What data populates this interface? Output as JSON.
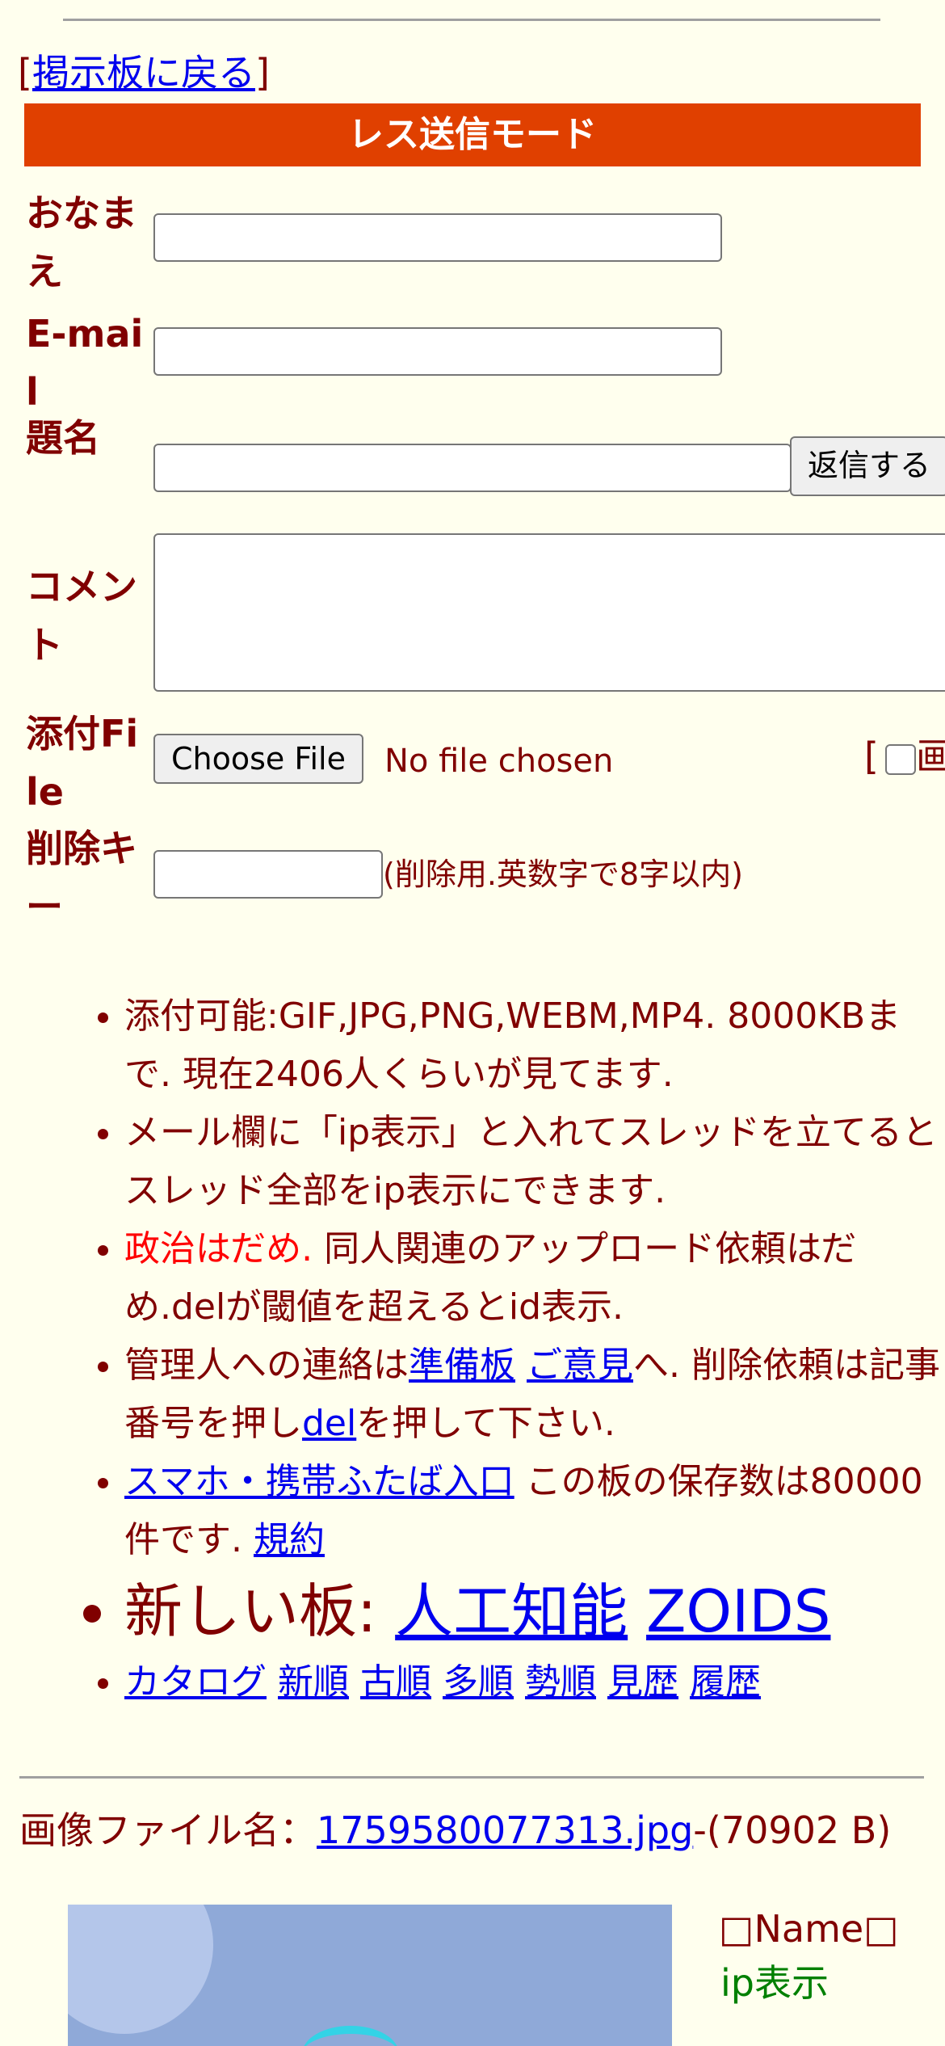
{
  "nav": {
    "back_left": "[",
    "back_link": "掲示板に戻る",
    "back_right": "]"
  },
  "mode_title": "レス送信モード",
  "form": {
    "name_label": "おなまえ",
    "email_label": "E-mail",
    "subject_label": "題名",
    "comment_label": "コメント",
    "attach_label": "添付File",
    "delkey_label": "削除キー",
    "submit_label": "返信する",
    "choose_file_label": "Choose File",
    "no_file_text": "No file chosen",
    "attach_extra_bracket": "[",
    "attach_extra_text": "画",
    "delkey_hint": "(削除用.英数字で8字以内)"
  },
  "notes": {
    "n1": "添付可能:GIF,JPG,PNG,WEBM,MP4. 8000KBまで. 現在2406人くらいが見てます.",
    "n2": "メール欄に「ip表示」と入れてスレッドを立てるとスレッド全部をip表示にできます.",
    "n3_red": "政治はだめ.",
    "n3_rest": " 同人関連のアップロード依頼はだめ.delが閾値を超えるとid表示.",
    "n4_a": "管理人への連絡は",
    "n4_link1": "準備板",
    "n4_link2": "ご意見",
    "n4_b": "へ. 削除依頼は記事番号を押し",
    "n4_link3": "del",
    "n4_c": "を押して下さい.",
    "n5_link": "スマホ・携帯ふたば入口",
    "n5_text": " この板の保存数は80000件です. ",
    "n5_link2": "規約",
    "n6_text": "新しい板: ",
    "n6_link1": "人工知能",
    "n6_link2": "ZOIDS",
    "n7_links": [
      "カタログ",
      "新順",
      "古順",
      "多順",
      "勢順",
      "見歴",
      "履歴"
    ]
  },
  "post": {
    "file_label": "画像ファイル名：",
    "file_link": "1759580077313.jpg",
    "file_size": "-(70902 B)",
    "name_label": "Name",
    "ip_label": "ip表示"
  },
  "colors": {
    "background": "#ffffee",
    "text": "#800000",
    "accent": "#e04000",
    "link": "#0000ee",
    "red": "#ff0000",
    "green": "#008000"
  }
}
